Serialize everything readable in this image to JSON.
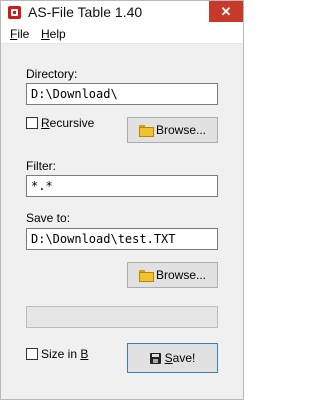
{
  "window": {
    "title": "AS-File Table 1.40",
    "close_glyph": "✕"
  },
  "menu": {
    "file": {
      "mnemonic": "F",
      "rest": "ile"
    },
    "help": {
      "mnemonic": "H",
      "rest": "elp"
    }
  },
  "directory": {
    "label": "Directory:",
    "value": "D:\\Download\\",
    "recursive": {
      "mnemonic": "R",
      "rest": "ecursive",
      "checked": false
    },
    "browse_label": "Browse..."
  },
  "filter": {
    "label": "Filter:",
    "value": "*.*"
  },
  "save_to": {
    "label": "Save to:",
    "value": "D:\\Download\\test.TXT",
    "browse_label": "Browse..."
  },
  "progress": {
    "value": 0
  },
  "size_in": {
    "prefix": "Size in ",
    "mnemonic": "B",
    "checked": false
  },
  "save": {
    "mnemonic": "S",
    "rest": "ave!"
  },
  "icons": {
    "app": "app-icon",
    "folder": "folder-icon",
    "disk": "floppy-disk-icon",
    "close": "close-icon"
  }
}
